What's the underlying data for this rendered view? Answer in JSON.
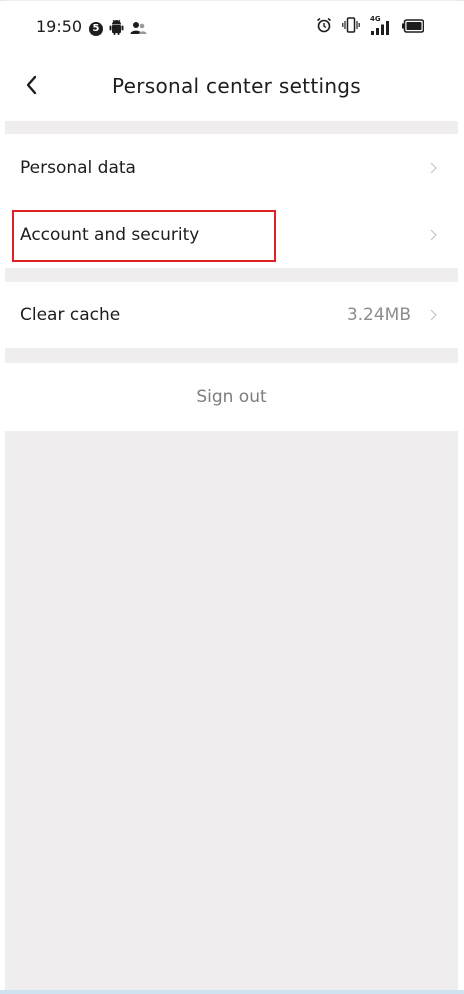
{
  "status_bar": {
    "time": "19:50",
    "notification_count": "5",
    "left_icons": [
      "badge-5-icon",
      "android-icon",
      "contacts-icon"
    ],
    "right_icons": [
      "alarm-icon",
      "vibrate-icon",
      "signal-4g-icon",
      "battery-icon"
    ],
    "network_label": "4G"
  },
  "header": {
    "title": "Personal center settings",
    "back_icon": "chevron-left-icon"
  },
  "settings": {
    "personal_data": "Personal data",
    "account_security": "Account and security",
    "clear_cache": "Clear cache",
    "cache_size": "3.24MB",
    "sign_out": "Sign out"
  },
  "colors": {
    "page_background": "#efedee",
    "row_background": "#ffffff",
    "highlight": "#e02020",
    "text_primary": "#1d1d1d",
    "text_secondary": "#8c8c8c"
  }
}
